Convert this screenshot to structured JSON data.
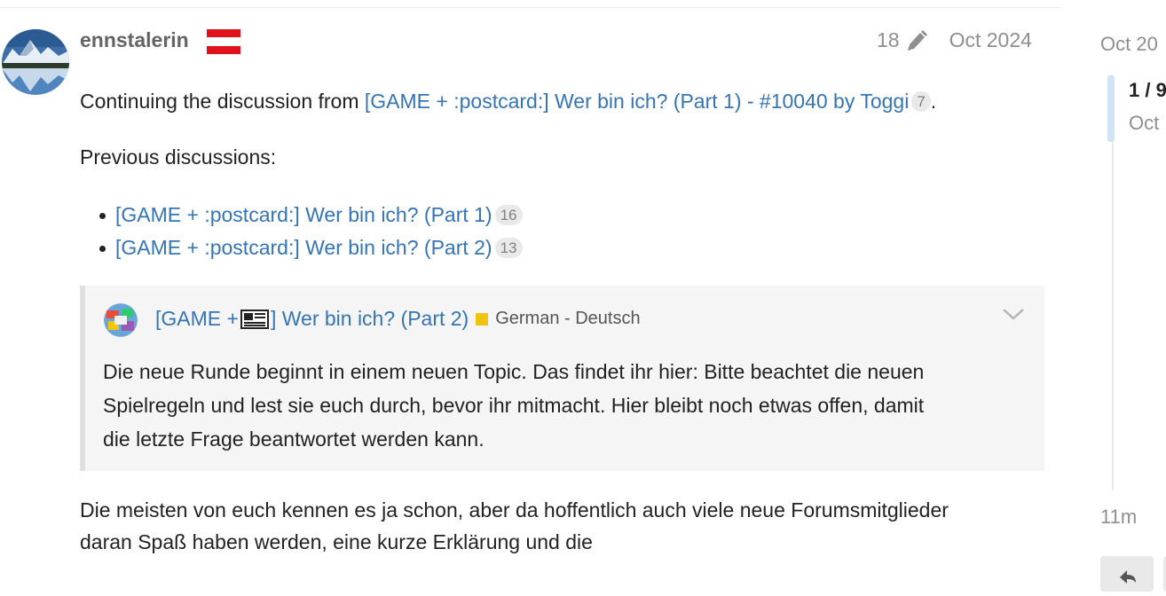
{
  "post": {
    "username": "ennstalerin",
    "edit_count": "18",
    "date": "Oct 2024",
    "intro_prefix": "Continuing the discussion from ",
    "intro_link": "[GAME + :postcard:] Wer bin ich? (Part 1) - #10040 by Toggi",
    "intro_link_count": "7",
    "intro_suffix": ".",
    "previous_label": "Previous discussions:",
    "previous_links": [
      {
        "label": "[GAME + :postcard:] Wer bin ich? (Part 1)",
        "count": "16"
      },
      {
        "label": "[GAME + :postcard:] Wer bin ich? (Part 2)",
        "count": "13"
      }
    ],
    "closing_lines": [
      "Die meisten von euch kennen es ja schon, aber da hoffentlich auch viele neue Forumsmitglieder",
      "daran Spaß haben werden, eine kurze Erklärung und die"
    ]
  },
  "quote": {
    "title_prefix": "[GAME + ",
    "title_suffix": "] Wer bin ich? (Part 2)",
    "category": "German - Deutsch",
    "category_color": "#f1c40f",
    "lines": [
      "Die neue Runde beginnt in einem neuen Topic. Das findet ihr hier: Bitte beachtet die neuen",
      "Spielregeln und lest sie euch durch, bevor ihr mitmacht. Hier bleibt noch etwas offen, damit",
      "die letzte Frage beantwortet werden kann."
    ]
  },
  "timeline": {
    "top_date": "Oct 20",
    "position": "1 / 9",
    "sub_date": "Oct",
    "bottom_date": "11m"
  },
  "colors": {
    "link": "#3474b7",
    "muted": "#8f8f8f",
    "flag_red": "#e0121b"
  },
  "icons": {
    "edit": "pencil-icon",
    "expand": "chevron-down-icon",
    "reply": "reply-icon"
  }
}
